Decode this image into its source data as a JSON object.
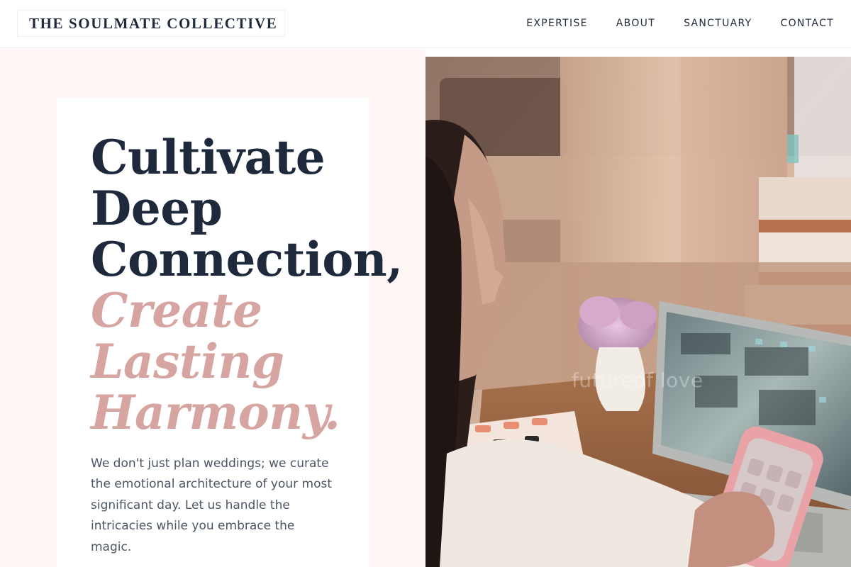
{
  "brand": {
    "name": "THE SOULMATE COLLECTIVE"
  },
  "nav": {
    "items": [
      {
        "label": "EXPERTISE"
      },
      {
        "label": "ABOUT"
      },
      {
        "label": "SANCTUARY"
      },
      {
        "label": "CONTACT"
      }
    ]
  },
  "hero": {
    "headline_lines": [
      "Cultivate",
      "Deep",
      "Connection,"
    ],
    "accent_lines": [
      "Create",
      "Lasting",
      "Harmony."
    ],
    "body": "We don't just plan weddings; we curate the emotional architecture of your most significant day. Let us handle the intricacies while you embrace the magic.",
    "image_watermark": "futureof love"
  },
  "colors": {
    "accent": "#d6a4a1",
    "heading": "#1e293b",
    "panel_bg": "#fff7f6"
  }
}
